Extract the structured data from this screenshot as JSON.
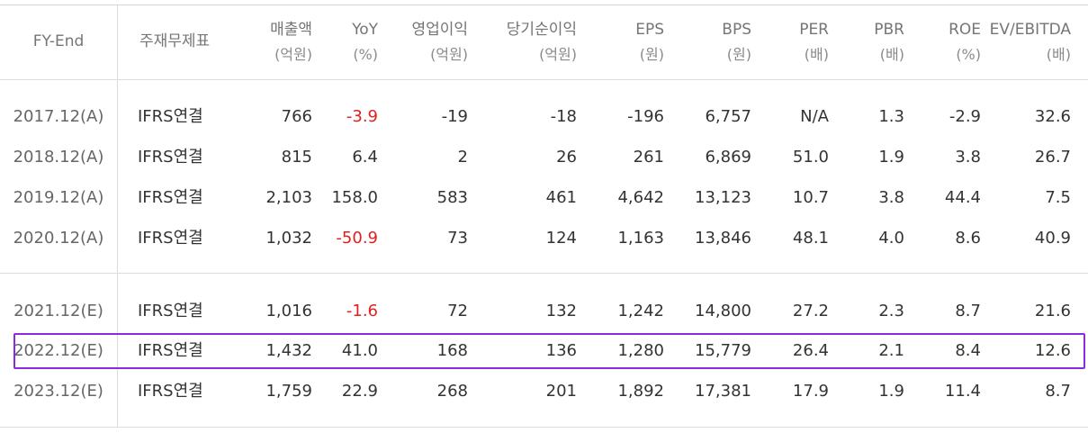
{
  "headers": {
    "fy": "FY-End",
    "type": "주재무제표",
    "sales": [
      "매출액",
      "(억원)"
    ],
    "yoy": [
      "YoY",
      "(%)"
    ],
    "op": [
      "영업이익",
      "(억원)"
    ],
    "net": [
      "당기순이익",
      "(억원)"
    ],
    "eps": [
      "EPS",
      "(원)"
    ],
    "bps": [
      "BPS",
      "(원)"
    ],
    "per": [
      "PER",
      "(배)"
    ],
    "pbr": [
      "PBR",
      "(배)"
    ],
    "roe": [
      "ROE",
      "(%)"
    ],
    "ev": [
      "EV/EBITDA",
      "(배)"
    ]
  },
  "rows": [
    {
      "fy": "2017.12(A)",
      "type": "IFRS연결",
      "sales": "766",
      "yoy": "-3.9",
      "op": "-19",
      "net": "-18",
      "eps": "-196",
      "bps": "6,757",
      "per": "N/A",
      "pbr": "1.3",
      "roe": "-2.9",
      "ev": "32.6"
    },
    {
      "fy": "2018.12(A)",
      "type": "IFRS연결",
      "sales": "815",
      "yoy": "6.4",
      "op": "2",
      "net": "26",
      "eps": "261",
      "bps": "6,869",
      "per": "51.0",
      "pbr": "1.9",
      "roe": "3.8",
      "ev": "26.7"
    },
    {
      "fy": "2019.12(A)",
      "type": "IFRS연결",
      "sales": "2,103",
      "yoy": "158.0",
      "op": "583",
      "net": "461",
      "eps": "4,642",
      "bps": "13,123",
      "per": "10.7",
      "pbr": "3.8",
      "roe": "44.4",
      "ev": "7.5"
    },
    {
      "fy": "2020.12(A)",
      "type": "IFRS연결",
      "sales": "1,032",
      "yoy": "-50.9",
      "op": "73",
      "net": "124",
      "eps": "1,163",
      "bps": "13,846",
      "per": "48.1",
      "pbr": "4.0",
      "roe": "8.6",
      "ev": "40.9"
    },
    {
      "fy": "2021.12(E)",
      "type": "IFRS연결",
      "sales": "1,016",
      "yoy": "-1.6",
      "op": "72",
      "net": "132",
      "eps": "1,242",
      "bps": "14,800",
      "per": "27.2",
      "pbr": "2.3",
      "roe": "8.7",
      "ev": "21.6"
    },
    {
      "fy": "2022.12(E)",
      "type": "IFRS연결",
      "sales": "1,432",
      "yoy": "41.0",
      "op": "168",
      "net": "136",
      "eps": "1,280",
      "bps": "15,779",
      "per": "26.4",
      "pbr": "2.1",
      "roe": "8.4",
      "ev": "12.6"
    },
    {
      "fy": "2023.12(E)",
      "type": "IFRS연결",
      "sales": "1,759",
      "yoy": "22.9",
      "op": "268",
      "net": "201",
      "eps": "1,892",
      "bps": "17,381",
      "per": "17.9",
      "pbr": "1.9",
      "roe": "11.4",
      "ev": "8.7"
    }
  ],
  "colors": {
    "negative": "#e02020",
    "highlight": "#8a2be2"
  }
}
